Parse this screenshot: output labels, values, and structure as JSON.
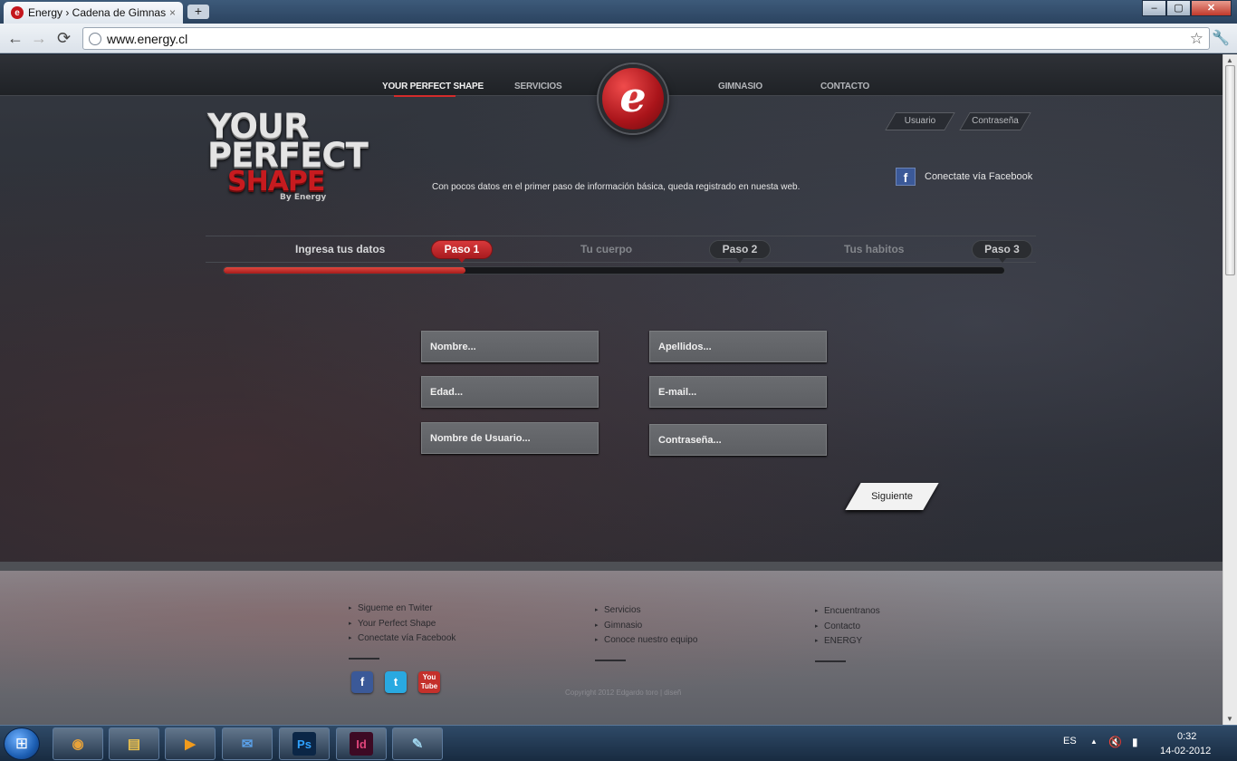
{
  "browser": {
    "tab_title": "Energy › Cadena de Gimnas",
    "tab_close": "×",
    "new_tab": "+",
    "url": "www.energy.cl",
    "back": "←",
    "forward": "→",
    "reload": "⟳",
    "star": "☆",
    "menu": "🔧",
    "win_min": "–",
    "win_max": "▢",
    "win_close": "✕"
  },
  "nav": {
    "items": [
      "YOUR PERFECT SHAPE",
      "SERVICIOS",
      "GIMNASIO",
      "CONTACTO"
    ],
    "logo_letter": "e"
  },
  "login": {
    "user_label": "Usuario",
    "password_label": "Contraseña"
  },
  "brand": {
    "line1": "YOUR",
    "line2": "PERFECT",
    "line3": "SHAPE",
    "by": "By Energy"
  },
  "intro_text": "Con pocos datos en el primer paso de información básica, queda registrado en nuesta web.",
  "facebook": {
    "icon_letter": "f",
    "label": "Conectate vía Facebook"
  },
  "steps": {
    "items": [
      {
        "label": "Ingresa tus datos",
        "pill": "Paso 1"
      },
      {
        "label": "Tu cuerpo",
        "pill": "Paso 2"
      },
      {
        "label": "Tus habitos",
        "pill": "Paso 3"
      }
    ],
    "progress": 0.31
  },
  "form": {
    "nombre": "Nombre...",
    "apellidos": "Apellidos...",
    "edad": "Edad...",
    "email": "E-mail...",
    "usuario": "Nombre de Usuario...",
    "contrasena": "Contraseña...",
    "submit": "Siguiente"
  },
  "footer": {
    "col1": [
      "Sigueme en Twiter",
      "Your Perfect Shape",
      "Conectate vía Facebook"
    ],
    "col2": [
      "Servicios",
      "Gimnasio",
      "Conoce nuestro equipo"
    ],
    "col3": [
      "Encuentranos",
      "Contacto",
      "ENERGY"
    ],
    "social": {
      "facebook": "f",
      "twitter": "t",
      "youtube": "You Tube"
    },
    "copyright": "Copyright 2012 Edgardo toro | diseñ"
  },
  "taskbar": {
    "start_glyph": "⊞",
    "apps": [
      {
        "name": "chrome",
        "glyph": "◉",
        "color": "#e8a33a"
      },
      {
        "name": "explorer",
        "glyph": "▤",
        "color": "#f0c44c"
      },
      {
        "name": "media-player",
        "glyph": "▶",
        "color": "#f29b1c"
      },
      {
        "name": "thunderbird",
        "glyph": "✉",
        "color": "#5aa0e8"
      },
      {
        "name": "photoshop",
        "glyph": "Ps",
        "color": "#2fa2ff"
      },
      {
        "name": "indesign",
        "glyph": "Id",
        "color": "#e0457b"
      },
      {
        "name": "notes",
        "glyph": "✎",
        "color": "#9ed3ec"
      }
    ],
    "lang": "ES",
    "tray_up": "▲",
    "volume": "🔇",
    "signal": "▮",
    "time": "0:32",
    "date": "14-02-2012"
  }
}
